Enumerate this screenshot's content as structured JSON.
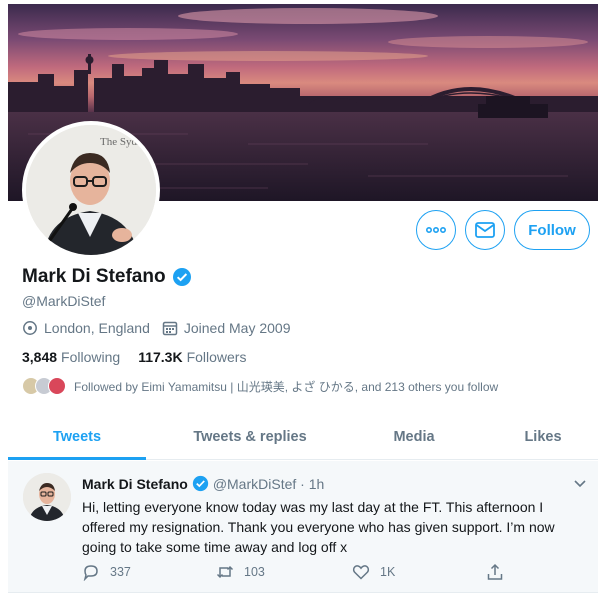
{
  "profile": {
    "name": "Mark Di Stefano",
    "handle": "@MarkDiStef",
    "location": "London, England",
    "joined": "Joined May 2009",
    "following_count": "3,848",
    "following_label": "Following",
    "followers_count": "117.3K",
    "followers_label": "Followers",
    "followed_by": "Followed by Eimi Yamamitsu | 山光瑛美, よざ ひかる, and 213 others you follow",
    "avatar_sign_text": "The Sydney Institute"
  },
  "actions": {
    "more_icon": "more-icon",
    "message_icon": "envelope-icon",
    "follow_label": "Follow"
  },
  "tabs": [
    {
      "label": "Tweets",
      "active": true
    },
    {
      "label": "Tweets & replies",
      "active": false
    },
    {
      "label": "Media",
      "active": false
    },
    {
      "label": "Likes",
      "active": false
    }
  ],
  "tweet": {
    "author": "Mark Di Stefano",
    "handle_time": "@MarkDiStef · 1h",
    "text": "Hi, letting everyone know today was my last day at the FT. This afternoon I offered my resignation. Thank you everyone who has given support. I’m now going to take some time away and log off x",
    "replies": "337",
    "retweets": "103",
    "likes": "1K"
  },
  "colors": {
    "accent": "#1da1f2",
    "text": "#14171a",
    "secondary": "#657786"
  }
}
